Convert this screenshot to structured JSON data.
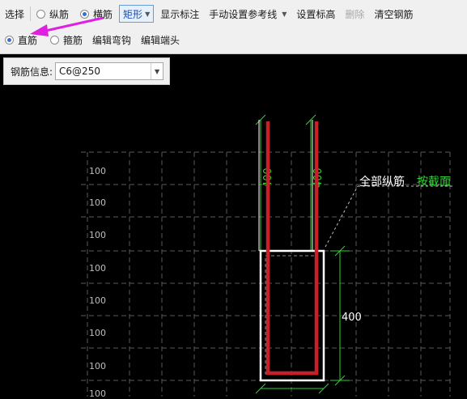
{
  "toolbar": {
    "row1": {
      "select": "选择",
      "longitudinal": "纵筋",
      "transverse": "横筋",
      "shape": "矩形",
      "show_dimension": "显示标注",
      "manual_ref_line": "手动设置参考线",
      "set_elevation": "设置标高",
      "delete": "删除",
      "clear_rebar": "清空钢筋"
    },
    "row2": {
      "straight": "直筋",
      "stirrup": "箍筋",
      "edit_hook": "编辑弯钩",
      "edit_end": "编辑端头"
    },
    "selected_row1": "transverse",
    "selected_row2": "straight"
  },
  "rebar_info": {
    "label": "钢筋信息:",
    "value": "C6@250"
  },
  "canvas": {
    "grid_label": "100",
    "grid_label_count": 8,
    "dim_left": "400",
    "dim_right": "400",
    "dim_side": "400",
    "annotation_main": "全部纵筋",
    "annotation_mode": "按截面"
  },
  "colors": {
    "rebar": "#c8202a",
    "annotation_green": "#2fd52f",
    "arrow": "#e020e0"
  },
  "icons": [
    "radio-icon",
    "dropdown-caret-icon",
    "pointer-arrow-icon"
  ]
}
